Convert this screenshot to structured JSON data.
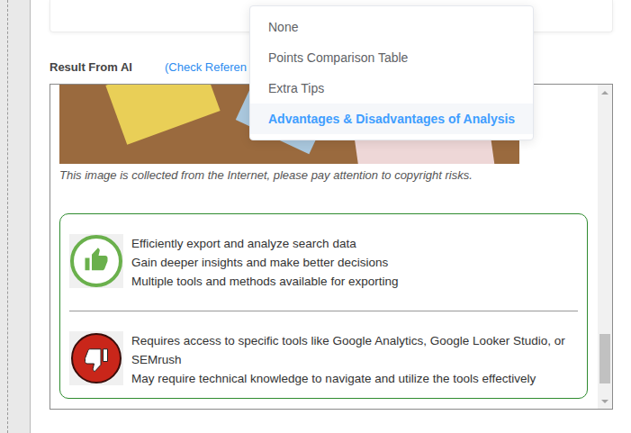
{
  "result": {
    "label": "Result From AI",
    "link": "(Check Referen",
    "caption": "This image is collected from the Internet, please pay attention to copyright risks.",
    "pros": [
      "Efficiently export and analyze search data",
      "Gain deeper insights and make better decisions",
      "Multiple tools and methods available for exporting"
    ],
    "cons": [
      "Requires access to specific tools like Google Analytics, Google Looker Studio, or SEMrush",
      "May require technical knowledge to navigate and utilize the tools effectively"
    ],
    "scrollbar": {
      "level": 0.96
    }
  },
  "dropdown": {
    "items": [
      {
        "label": "None",
        "selected": false
      },
      {
        "label": "Points Comparison Table",
        "selected": false
      },
      {
        "label": "Extra Tips",
        "selected": false
      },
      {
        "label": "Advantages & Disadvantages of Analysis",
        "selected": true
      }
    ]
  }
}
